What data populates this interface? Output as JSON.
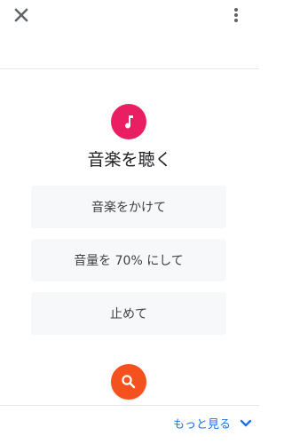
{
  "header": {
    "close_icon": "close-icon",
    "menu_icon": "more-vert-icon"
  },
  "feature": {
    "icon": "music-note-icon",
    "icon_bg_color": "#e91e63",
    "title": "音楽を聴く"
  },
  "suggestions": [
    {
      "label": "音楽をかけて"
    },
    {
      "label": "音量を 70% にして"
    },
    {
      "label": "止めて"
    }
  ],
  "search": {
    "icon": "search-icon",
    "color": "#f4511e"
  },
  "footer": {
    "more_label": "もっと見る",
    "chevron_icon": "chevron-down-icon",
    "link_color": "#1a73e8"
  }
}
